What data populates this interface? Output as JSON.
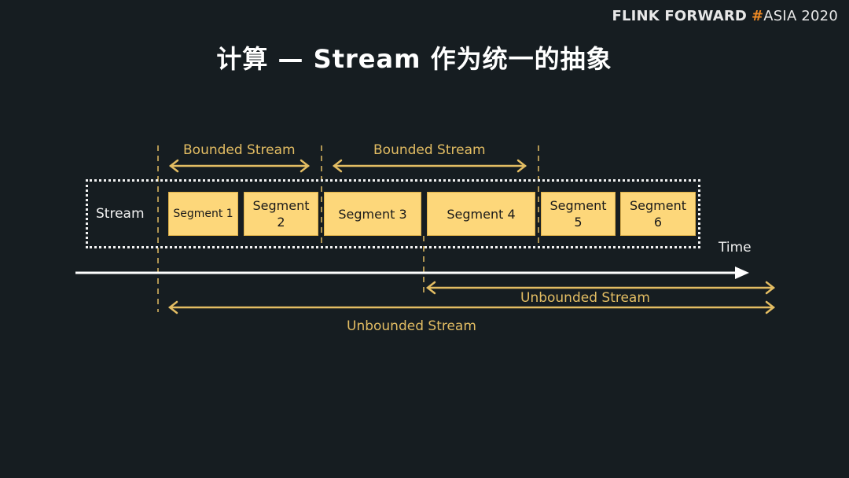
{
  "brand": {
    "part1": "FLINK FORWARD",
    "hash": "#",
    "part2": "ASIA 2020",
    "accent_color": "#f08a24"
  },
  "title": "计算 — Stream 作为统一的抽象",
  "diagram": {
    "stream_label": "Stream",
    "time_label": "Time",
    "segments": [
      {
        "line1": "Segment 1",
        "line2": ""
      },
      {
        "line1": "Segment",
        "line2": "2"
      },
      {
        "line1": "Segment 3",
        "line2": ""
      },
      {
        "line1": "Segment 4",
        "line2": ""
      },
      {
        "line1": "Segment",
        "line2": "5"
      },
      {
        "line1": "Segment",
        "line2": "6"
      }
    ],
    "bounded_labels": [
      "Bounded Stream",
      "Bounded Stream"
    ],
    "unbounded_labels": [
      "Unbounded Stream",
      "Unbounded Stream"
    ],
    "colors": {
      "segment_fill": "#fdd77a",
      "gold": "#e3bd63",
      "background": "#161d21",
      "white": "#f2f2f2"
    }
  }
}
